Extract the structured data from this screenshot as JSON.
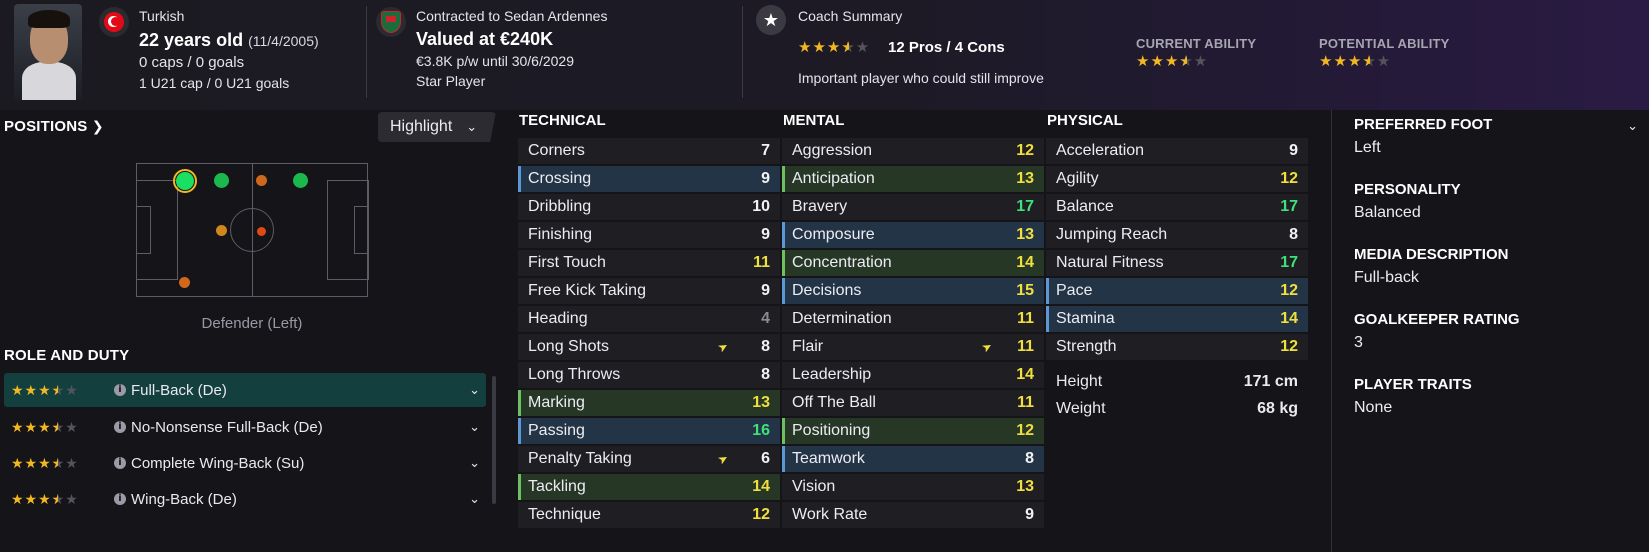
{
  "header": {
    "nationality": "Turkish",
    "age": "22 years old",
    "dob": "(11/4/2005)",
    "caps": "0 caps / 0 goals",
    "u21_caps": "1 U21 cap / 0 U21 goals",
    "contract_text": "Contracted to Sedan Ardennes",
    "value": "Valued at €240K",
    "wage": "€3.8K p/w until 30/6/2029",
    "status": "Star Player",
    "coach_title": "Coach Summary",
    "coach_pros_cons": "12 Pros / 4 Cons",
    "coach_note": "Important player who could still improve",
    "coach_stars": 3.5,
    "current_ability_label": "CURRENT ABILITY",
    "current_ability_stars": 3.5,
    "potential_ability_label": "POTENTIAL ABILITY",
    "potential_ability_stars": 3.5
  },
  "positions": {
    "title": "POSITIONS",
    "highlight_label": "Highlight",
    "caption": "Defender (Left)"
  },
  "roles": {
    "title": "ROLE AND DUTY",
    "items": [
      {
        "label": "Full-Back (De)",
        "stars": 3.5
      },
      {
        "label": "No-Nonsense Full-Back (De)",
        "stars": 3.5
      },
      {
        "label": "Complete Wing-Back (Su)",
        "stars": 3.5
      },
      {
        "label": "Wing-Back (De)",
        "stars": 3.5
      }
    ]
  },
  "technical": {
    "title": "TECHNICAL",
    "rows": [
      {
        "name": "Corners",
        "value": "7",
        "color": "white",
        "hl": ""
      },
      {
        "name": "Crossing",
        "value": "9",
        "color": "white",
        "hl": "blue"
      },
      {
        "name": "Dribbling",
        "value": "10",
        "color": "white",
        "hl": ""
      },
      {
        "name": "Finishing",
        "value": "9",
        "color": "white",
        "hl": ""
      },
      {
        "name": "First Touch",
        "value": "11",
        "color": "yellow",
        "hl": ""
      },
      {
        "name": "Free Kick Taking",
        "value": "9",
        "color": "white",
        "hl": ""
      },
      {
        "name": "Heading",
        "value": "4",
        "color": "grey",
        "hl": ""
      },
      {
        "name": "Long Shots",
        "value": "8",
        "color": "white",
        "hl": "",
        "icon": true
      },
      {
        "name": "Long Throws",
        "value": "8",
        "color": "white",
        "hl": ""
      },
      {
        "name": "Marking",
        "value": "13",
        "color": "yellow",
        "hl": "green"
      },
      {
        "name": "Passing",
        "value": "16",
        "color": "green",
        "hl": "blue"
      },
      {
        "name": "Penalty Taking",
        "value": "6",
        "color": "white",
        "hl": "",
        "icon": true
      },
      {
        "name": "Tackling",
        "value": "14",
        "color": "yellow",
        "hl": "green"
      },
      {
        "name": "Technique",
        "value": "12",
        "color": "yellow",
        "hl": ""
      }
    ]
  },
  "mental": {
    "title": "MENTAL",
    "rows": [
      {
        "name": "Aggression",
        "value": "12",
        "color": "yellow",
        "hl": ""
      },
      {
        "name": "Anticipation",
        "value": "13",
        "color": "yellow",
        "hl": "green"
      },
      {
        "name": "Bravery",
        "value": "17",
        "color": "green",
        "hl": ""
      },
      {
        "name": "Composure",
        "value": "13",
        "color": "yellow",
        "hl": "blue"
      },
      {
        "name": "Concentration",
        "value": "14",
        "color": "yellow",
        "hl": "green"
      },
      {
        "name": "Decisions",
        "value": "15",
        "color": "yellow",
        "hl": "blue"
      },
      {
        "name": "Determination",
        "value": "11",
        "color": "yellow",
        "hl": ""
      },
      {
        "name": "Flair",
        "value": "11",
        "color": "yellow",
        "hl": "",
        "icon": true
      },
      {
        "name": "Leadership",
        "value": "14",
        "color": "yellow",
        "hl": ""
      },
      {
        "name": "Off The Ball",
        "value": "11",
        "color": "yellow",
        "hl": ""
      },
      {
        "name": "Positioning",
        "value": "12",
        "color": "yellow",
        "hl": "green"
      },
      {
        "name": "Teamwork",
        "value": "8",
        "color": "white",
        "hl": "blue"
      },
      {
        "name": "Vision",
        "value": "13",
        "color": "yellow",
        "hl": ""
      },
      {
        "name": "Work Rate",
        "value": "9",
        "color": "white",
        "hl": ""
      }
    ]
  },
  "physical": {
    "title": "PHYSICAL",
    "rows": [
      {
        "name": "Acceleration",
        "value": "9",
        "color": "white",
        "hl": ""
      },
      {
        "name": "Agility",
        "value": "12",
        "color": "yellow",
        "hl": ""
      },
      {
        "name": "Balance",
        "value": "17",
        "color": "green",
        "hl": ""
      },
      {
        "name": "Jumping Reach",
        "value": "8",
        "color": "white",
        "hl": ""
      },
      {
        "name": "Natural Fitness",
        "value": "17",
        "color": "green",
        "hl": ""
      },
      {
        "name": "Pace",
        "value": "12",
        "color": "yellow",
        "hl": "blue"
      },
      {
        "name": "Stamina",
        "value": "14",
        "color": "yellow",
        "hl": "blue"
      },
      {
        "name": "Strength",
        "value": "12",
        "color": "yellow",
        "hl": ""
      }
    ],
    "height_label": "Height",
    "height_value": "171 cm",
    "weight_label": "Weight",
    "weight_value": "68 kg"
  },
  "info": {
    "preferred_foot_title": "PREFERRED FOOT",
    "preferred_foot": "Left",
    "personality_title": "PERSONALITY",
    "personality": "Balanced",
    "media_title": "MEDIA DESCRIPTION",
    "media": "Full-back",
    "gk_title": "GOALKEEPER RATING",
    "gk": "3",
    "traits_title": "PLAYER TRAITS",
    "traits": "None"
  },
  "colors": {
    "value_white": "#f2f2f2",
    "value_grey": "#8b8a93",
    "value_yellow": "#f1df3c",
    "value_green": "#3fe27a",
    "highlight_blue": "#5c98d6",
    "highlight_green": "#6fbf63",
    "star": "#f2b822"
  },
  "icons": [
    "turkey-flag-icon",
    "club-crest-icon",
    "star-icon",
    "chevron-right-icon",
    "chevron-down-icon",
    "info-icon",
    "flair-arrow-icon"
  ]
}
